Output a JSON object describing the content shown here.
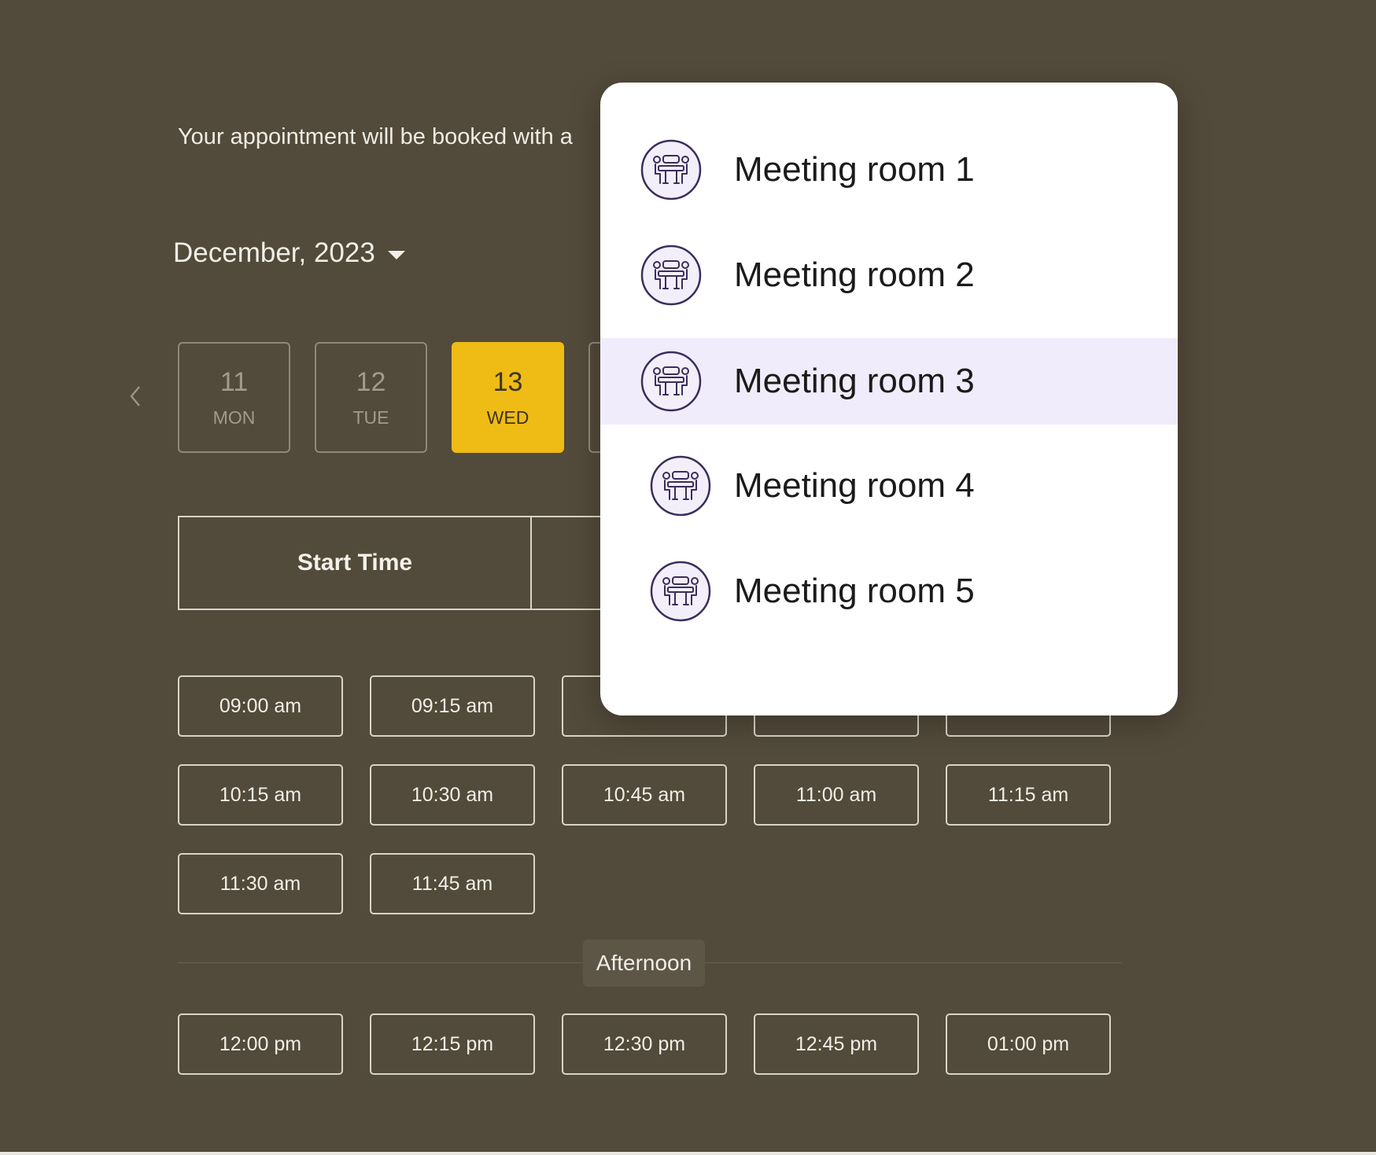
{
  "intro": {
    "text": "Your appointment will be booked with a"
  },
  "calendar": {
    "month_label": "December, 2023",
    "days": [
      {
        "num": "11",
        "dow": "MON",
        "active": false
      },
      {
        "num": "12",
        "dow": "TUE",
        "active": false
      },
      {
        "num": "13",
        "dow": "WED",
        "active": true
      }
    ]
  },
  "time_mode": {
    "start_label": "Start Time"
  },
  "morning_slots": [
    "09:00 am",
    "09:15 am",
    "10:15 am",
    "10:30 am",
    "10:45 am",
    "11:00 am",
    "11:15 am",
    "11:30 am",
    "11:45 am"
  ],
  "afternoon": {
    "label": "Afternoon",
    "slots": [
      "12:00 pm",
      "12:15 pm",
      "12:30 pm",
      "12:45 pm",
      "01:00 pm"
    ]
  },
  "dropdown": {
    "options": [
      {
        "label": "Meeting room 1",
        "selected": false
      },
      {
        "label": "Meeting room 2",
        "selected": false
      },
      {
        "label": "Meeting room 3",
        "selected": true
      },
      {
        "label": "Meeting room 4",
        "selected": false
      },
      {
        "label": "Meeting room 5",
        "selected": false
      }
    ],
    "icon": "meeting-room-icon"
  },
  "colors": {
    "background": "#524a3a",
    "accent_selected_day": "#efbb15",
    "dropdown_selected_row": "#f1ecfb",
    "icon_stroke": "#3b2d5c",
    "icon_fill": "#f3effa"
  }
}
